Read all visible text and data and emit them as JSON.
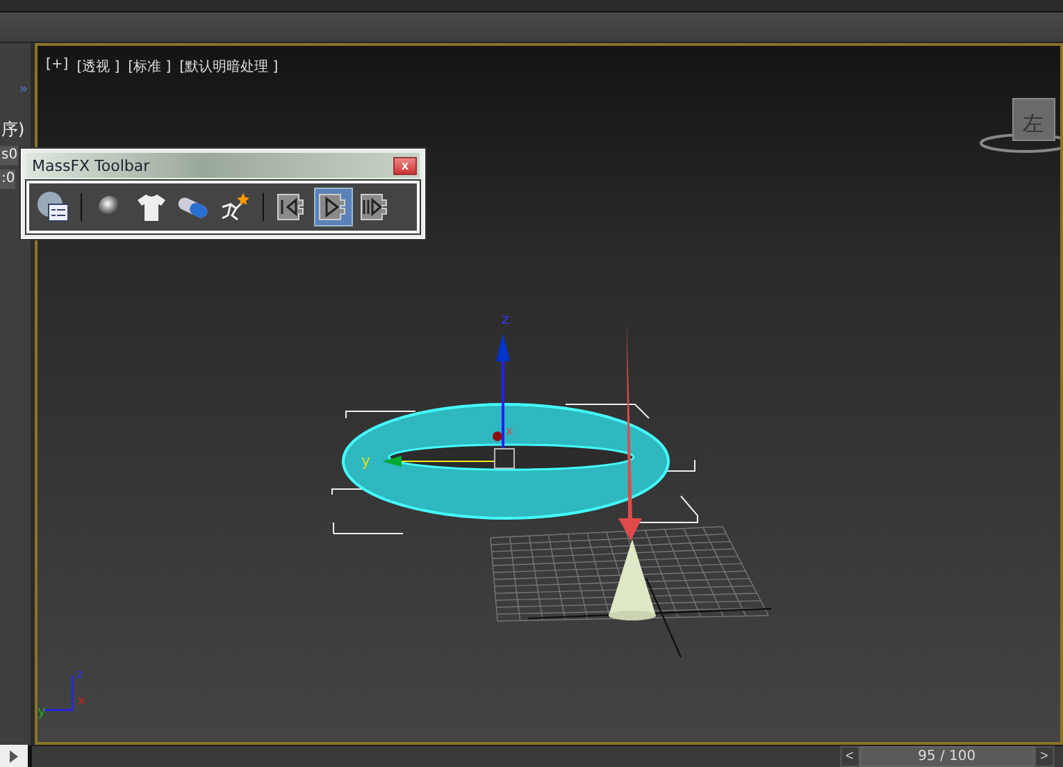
{
  "side_panel": {
    "expand": "»",
    "texts": [
      "序)",
      "s0",
      ":0"
    ]
  },
  "viewport": {
    "labels": [
      "[+]",
      "[透视 ]",
      "[标准 ]",
      "[默认明暗处理 ]"
    ],
    "viewcube": {
      "face": "左"
    },
    "gizmo": {
      "z": "z",
      "y": "y",
      "x": "x"
    },
    "corner_axes": {
      "z": "z",
      "x": "x",
      "y": "y"
    }
  },
  "toolbar": {
    "title": "MassFX Toolbar",
    "close": "x",
    "tool_groups": [
      [
        {
          "kind": "world",
          "selected": false
        }
      ],
      [
        {
          "kind": "sphere",
          "selected": false
        },
        {
          "kind": "shirt",
          "selected": false
        },
        {
          "kind": "capsule",
          "selected": false
        },
        {
          "kind": "ragdoll",
          "selected": false
        }
      ],
      [
        {
          "kind": "reset",
          "selected": false
        },
        {
          "kind": "play",
          "selected": true
        },
        {
          "kind": "step",
          "selected": false
        }
      ]
    ]
  },
  "timeline": {
    "prev": "<",
    "frame": "95 / 100",
    "next": ">",
    "level": 0.95
  }
}
